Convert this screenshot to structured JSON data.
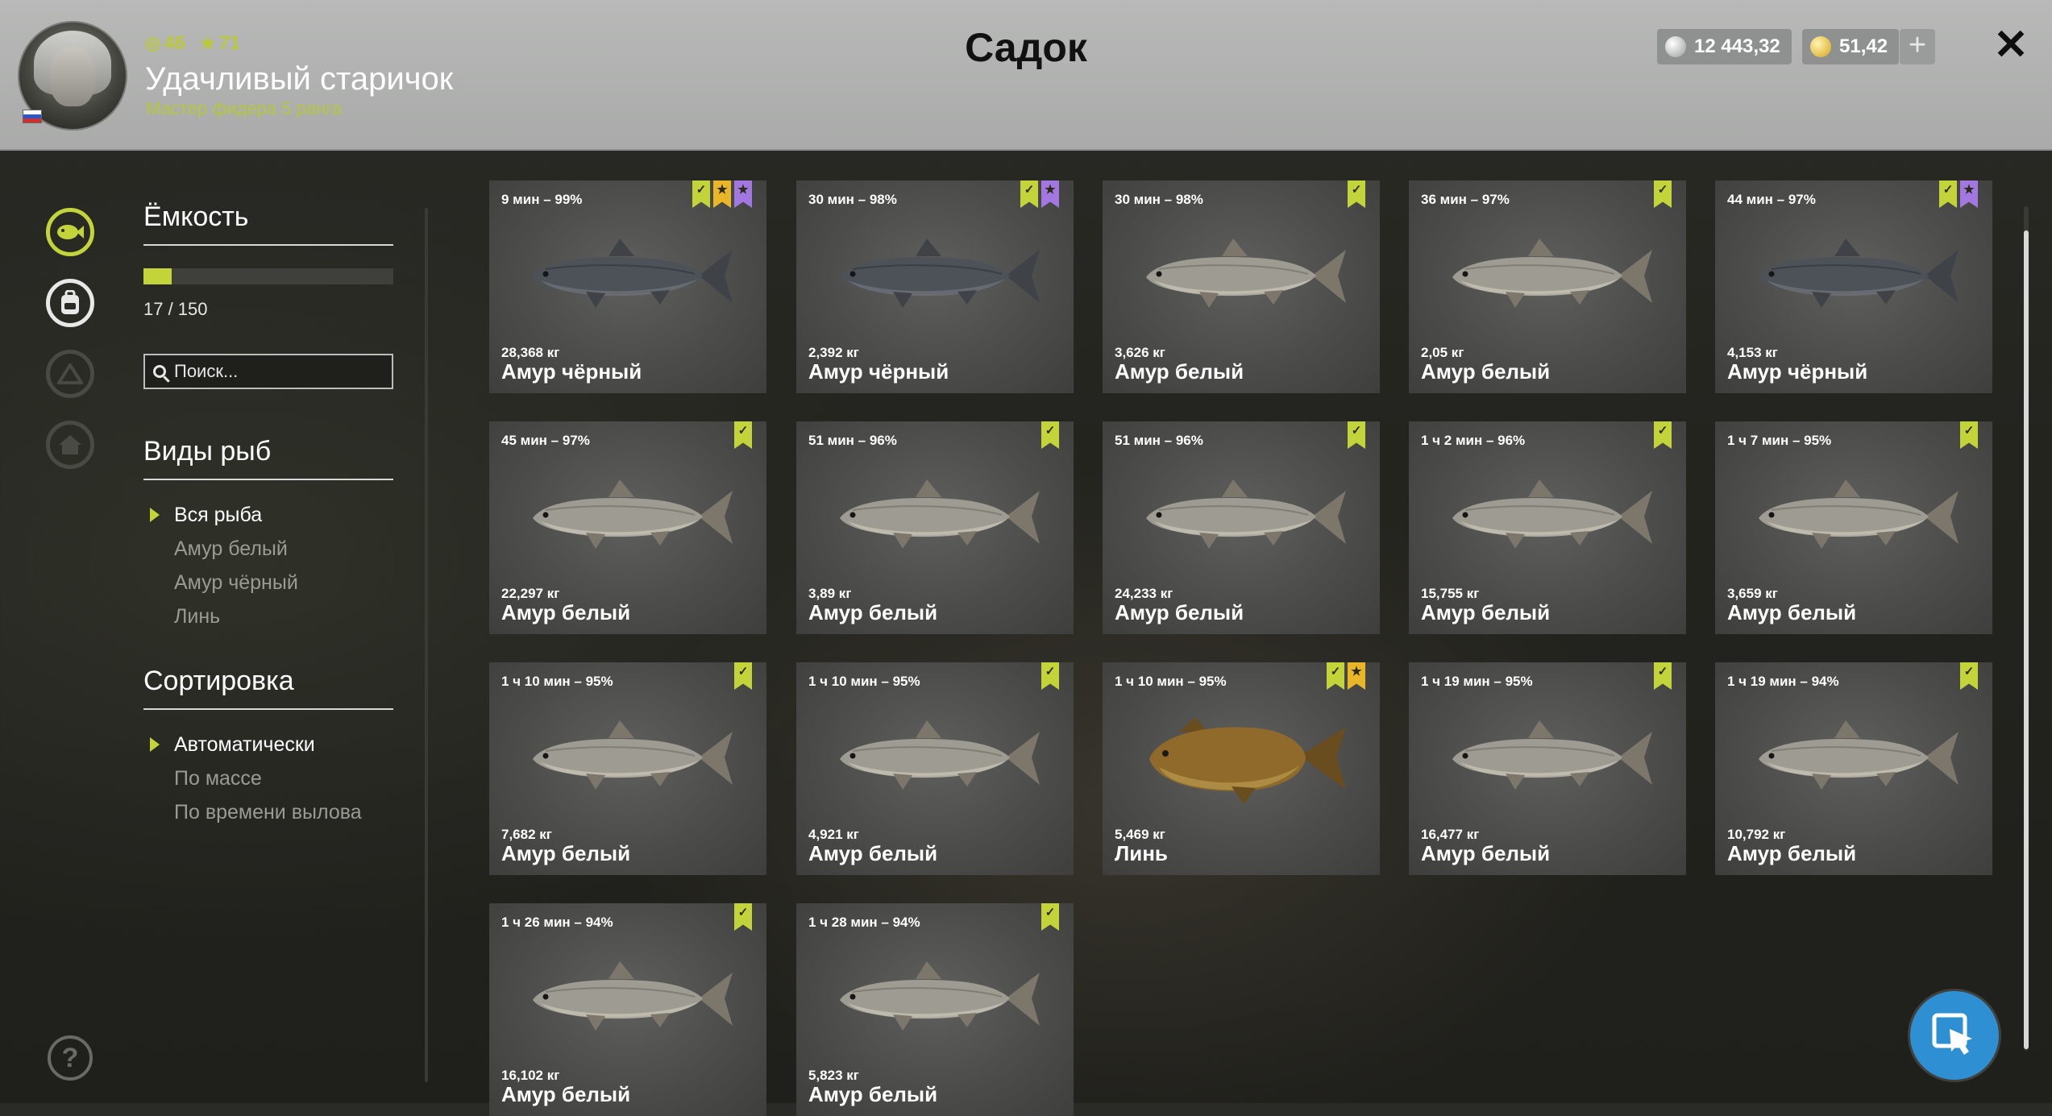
{
  "header": {
    "title": "Садок",
    "player": {
      "name": "Удачливый старичок",
      "rank": "Мастер фидера 5 ранга",
      "level": "46",
      "stars": "71"
    },
    "silver": "12 443,32",
    "gold": "51,42",
    "add_label": "+",
    "close_label": "✕"
  },
  "rail": {
    "icons": [
      "fish-tank-icon",
      "backpack-icon",
      "camp-icon",
      "home-icon"
    ],
    "help_label": "?"
  },
  "capacity": {
    "title": "Ёмкость",
    "current": 17,
    "max": 150,
    "text": "17 / 150"
  },
  "search": {
    "placeholder": "Поиск..."
  },
  "species": {
    "title": "Виды рыб",
    "options": [
      "Вся рыба",
      "Амур белый",
      "Амур чёрный",
      "Линь"
    ],
    "selected": 0
  },
  "sorting": {
    "title": "Сортировка",
    "options": [
      "Автоматически",
      "По массе",
      "По времени вылова"
    ],
    "selected": 0
  },
  "colors": {
    "accent": "#c3d43a",
    "badge_star": "#e9b628",
    "badge_purple": "#a277e0",
    "cursor_button": "#2f8fd3"
  },
  "fish": [
    {
      "time": "9 мин – 99%",
      "weight": "28,368 кг",
      "name": "Амур чёрный",
      "badges": [
        "g",
        "y",
        "p"
      ],
      "kind": "black"
    },
    {
      "time": "30 мин – 98%",
      "weight": "2,392 кг",
      "name": "Амур чёрный",
      "badges": [
        "g",
        "p"
      ],
      "kind": "black"
    },
    {
      "time": "30 мин – 98%",
      "weight": "3,626 кг",
      "name": "Амур белый",
      "badges": [
        "g"
      ],
      "kind": "white"
    },
    {
      "time": "36 мин – 97%",
      "weight": "2,05 кг",
      "name": "Амур белый",
      "badges": [
        "g"
      ],
      "kind": "white"
    },
    {
      "time": "44 мин – 97%",
      "weight": "4,153 кг",
      "name": "Амур чёрный",
      "badges": [
        "g",
        "p"
      ],
      "kind": "black"
    },
    {
      "time": "45 мин – 97%",
      "weight": "22,297 кг",
      "name": "Амур белый",
      "badges": [
        "g"
      ],
      "kind": "white"
    },
    {
      "time": "51 мин – 96%",
      "weight": "3,89 кг",
      "name": "Амур белый",
      "badges": [
        "g"
      ],
      "kind": "white"
    },
    {
      "time": "51 мин – 96%",
      "weight": "24,233 кг",
      "name": "Амур белый",
      "badges": [
        "g"
      ],
      "kind": "white"
    },
    {
      "time": "1 ч 2 мин – 96%",
      "weight": "15,755 кг",
      "name": "Амур белый",
      "badges": [
        "g"
      ],
      "kind": "white"
    },
    {
      "time": "1 ч 7 мин – 95%",
      "weight": "3,659 кг",
      "name": "Амур белый",
      "badges": [
        "g"
      ],
      "kind": "white"
    },
    {
      "time": "1 ч 10 мин – 95%",
      "weight": "7,682 кг",
      "name": "Амур белый",
      "badges": [
        "g"
      ],
      "kind": "white"
    },
    {
      "time": "1 ч 10 мин – 95%",
      "weight": "4,921 кг",
      "name": "Амур белый",
      "badges": [
        "g"
      ],
      "kind": "white"
    },
    {
      "time": "1 ч 10 мин – 95%",
      "weight": "5,469 кг",
      "name": "Линь",
      "badges": [
        "g",
        "y"
      ],
      "kind": "tench"
    },
    {
      "time": "1 ч 19 мин – 95%",
      "weight": "16,477 кг",
      "name": "Амур белый",
      "badges": [
        "g"
      ],
      "kind": "white"
    },
    {
      "time": "1 ч 19 мин – 94%",
      "weight": "10,792 кг",
      "name": "Амур белый",
      "badges": [
        "g"
      ],
      "kind": "white"
    },
    {
      "time": "1 ч 26 мин – 94%",
      "weight": "16,102 кг",
      "name": "Амур белый",
      "badges": [
        "g"
      ],
      "kind": "white"
    },
    {
      "time": "1 ч 28 мин – 94%",
      "weight": "5,823 кг",
      "name": "Амур белый",
      "badges": [
        "g"
      ],
      "kind": "white"
    }
  ]
}
